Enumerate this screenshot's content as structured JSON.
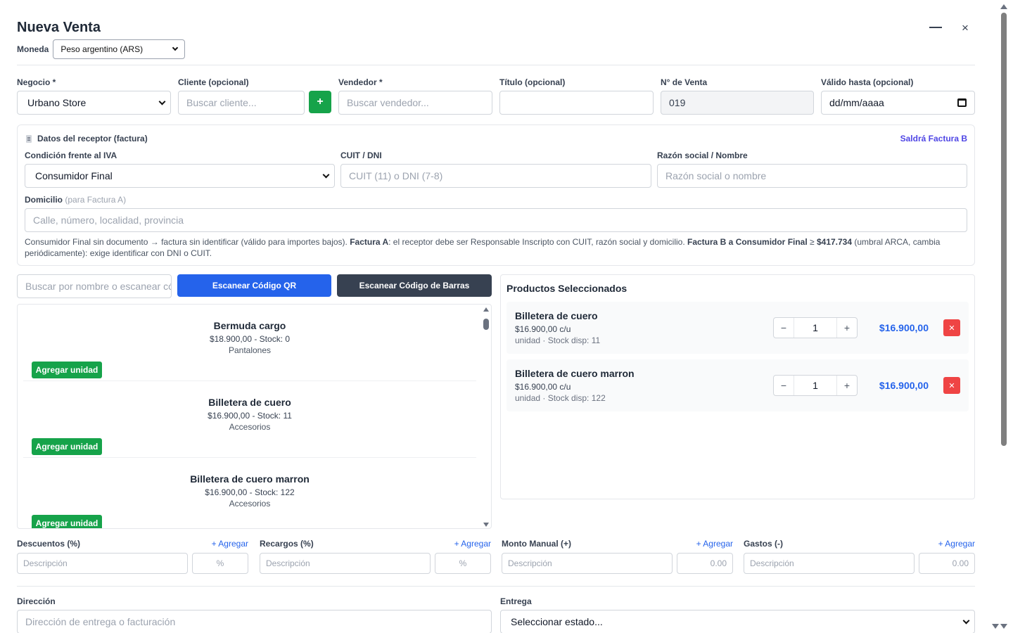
{
  "header": {
    "title": "Nueva Venta"
  },
  "currency": {
    "label": "Moneda",
    "value": "Peso argentino (ARS)"
  },
  "fields": {
    "negocio": {
      "label": "Negocio *",
      "value": "Urbano Store"
    },
    "cliente": {
      "label": "Cliente (opcional)",
      "placeholder": "Buscar cliente...",
      "add_label": "+"
    },
    "vendedor": {
      "label": "Vendedor *",
      "placeholder": "Buscar vendedor..."
    },
    "titulo": {
      "label": "Título (opcional)",
      "placeholder": ""
    },
    "numero": {
      "label": "N° de Venta",
      "value": "019"
    },
    "valido": {
      "label": "Válido hasta (opcional)",
      "placeholder": "dd/mm/aaaa"
    }
  },
  "receptor": {
    "title": "Datos del receptor (factura)",
    "badge": "Saldrá Factura B",
    "condicion": {
      "label": "Condición frente al IVA",
      "value": "Consumidor Final"
    },
    "cuit": {
      "label": "CUIT / DNI",
      "placeholder": "CUIT (11) o DNI (7-8)"
    },
    "razon": {
      "label": "Razón social / Nombre",
      "placeholder": "Razón social o nombre"
    },
    "domicilio": {
      "label": "Domicilio",
      "label_note": "(para Factura A)",
      "placeholder": "Calle, número, localidad, provincia"
    },
    "help": {
      "p1": "Consumidor Final sin documento → factura sin identificar (válido para importes bajos). ",
      "b1": "Factura A",
      "p2": ": el receptor debe ser Responsable Inscripto con CUIT, razón social y domicilio. ",
      "b2": "Factura B a Consumidor Final",
      "p3": " ≥ ",
      "b3": "$417.734",
      "p4": " (umbral ARCA, cambia periódicamente): exige identificar con DNI o CUIT."
    }
  },
  "products": {
    "search_placeholder": "Buscar por nombre o escanear código",
    "qr_label": "Escanear Código QR",
    "barcode_label": "Escanear Código de Barras",
    "add_label": "Agregar unidad",
    "items": [
      {
        "name": "Bermuda cargo",
        "meta": "$18.900,00 - Stock: 0",
        "category": "Pantalones"
      },
      {
        "name": "Billetera de cuero",
        "meta": "$16.900,00 - Stock: 11",
        "category": "Accesorios"
      },
      {
        "name": "Billetera de cuero marron",
        "meta": "$16.900,00 - Stock: 122",
        "category": "Accesorios"
      }
    ]
  },
  "selected": {
    "title": "Productos Seleccionados",
    "items": [
      {
        "name": "Billetera de cuero",
        "unit_price": "$16.900,00 c/u",
        "stock": "unidad · Stock disp: 11",
        "qty": "1",
        "total": "$16.900,00"
      },
      {
        "name": "Billetera de cuero marron",
        "unit_price": "$16.900,00 c/u",
        "stock": "unidad · Stock disp: 122",
        "qty": "1",
        "total": "$16.900,00"
      }
    ]
  },
  "adjustments": {
    "add_label": "+ Agregar",
    "desc_placeholder": "Descripción",
    "items": [
      {
        "label": "Descuentos (%)",
        "value_placeholder": "%"
      },
      {
        "label": "Recargos (%)",
        "value_placeholder": "%"
      },
      {
        "label": "Monto Manual (+)",
        "value_placeholder": "0.00"
      },
      {
        "label": "Gastos (-)",
        "value_placeholder": "0.00"
      }
    ]
  },
  "bottom": {
    "direccion": {
      "label": "Dirección",
      "placeholder": "Dirección de entrega o facturación"
    },
    "entrega": {
      "label": "Entrega",
      "value": "Seleccionar estado..."
    }
  },
  "colors": {
    "primary": "#2563eb",
    "success": "#16a34a",
    "danger": "#ef4444",
    "dark": "#374151",
    "accent": "#4f46e5"
  }
}
